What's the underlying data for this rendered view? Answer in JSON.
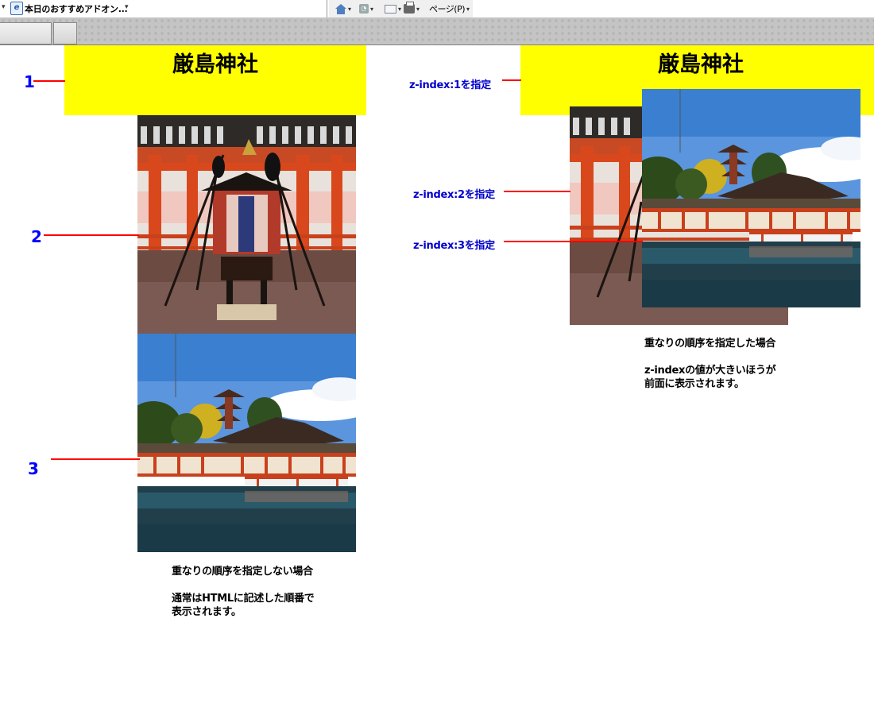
{
  "browser": {
    "tab_title": "本日のおすすめアドオン...",
    "page_menu": "ページ(P)",
    "fav_icon": "ie-favicon-icon",
    "commands": [
      "home-icon",
      "rss-icon",
      "mail-icon",
      "print-icon"
    ]
  },
  "left": {
    "banner_title": "厳島神社",
    "labels": [
      "1",
      "2",
      "3"
    ],
    "caption_title": "重なりの順序を指定しない場合",
    "caption_line1": "通常はHTMLに記述した順番で",
    "caption_line2": "表示されます。"
  },
  "right": {
    "banner_title": "厳島神社",
    "z1_label": "z-index:1を指定",
    "z2_label": "z-index:2を指定",
    "z3_label": "z-index:3を指定",
    "caption_title": "重なりの順序を指定した場合",
    "caption_line1": "z-indexの値が大きいほうが",
    "caption_line2": "前面に表示されます。"
  },
  "colors": {
    "banner": "#ffff00",
    "label_blue": "#0000ff",
    "line_red": "#ff0000"
  }
}
